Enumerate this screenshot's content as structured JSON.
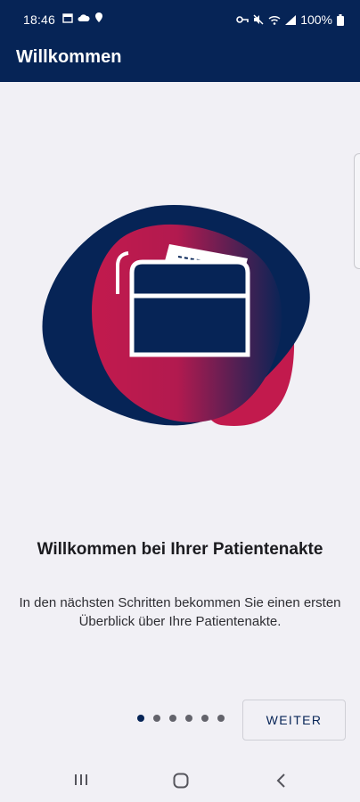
{
  "status_bar": {
    "time": "18:46",
    "battery": "100%",
    "icons": [
      "calendar-icon",
      "cloud-icon",
      "location-icon",
      "key-icon",
      "mute-icon",
      "wifi-icon",
      "signal-icon",
      "battery-icon"
    ]
  },
  "app_bar": {
    "title": "Willkommen"
  },
  "onboarding": {
    "headline": "Willkommen bei Ihrer Patientenakte",
    "description": "In den nächsten Schritten bekommen Sie einen ersten Überblick über Ihre Patientenakte.",
    "current_page": 1,
    "page_count": 6,
    "next_label": "WEITER"
  },
  "nav_bar": {
    "icons": [
      "recent-apps-icon",
      "home-icon",
      "back-icon"
    ]
  },
  "colors": {
    "primary": "#062456",
    "accent": "#c21a4d",
    "background": "#f1f0f5"
  }
}
